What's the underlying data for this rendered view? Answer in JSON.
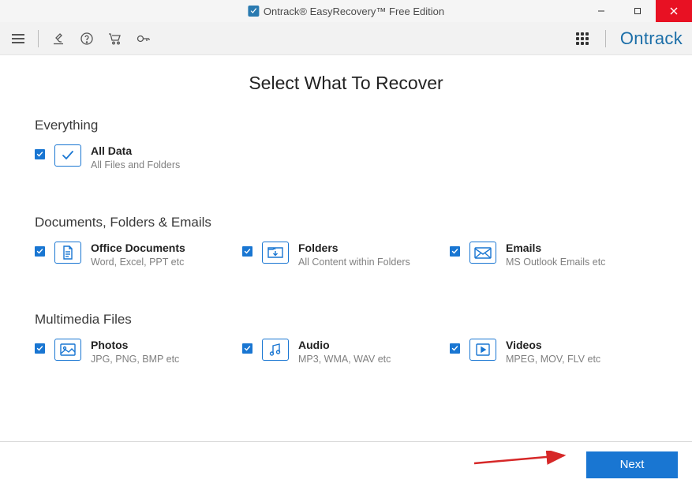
{
  "titlebar": {
    "title": "Ontrack® EasyRecovery™ Free Edition"
  },
  "brand": "Ontrack",
  "page_title": "Select What To Recover",
  "sections": {
    "everything": {
      "title": "Everything",
      "all_data": {
        "label": "All Data",
        "sub": "All Files and Folders"
      }
    },
    "docs": {
      "title": "Documents, Folders & Emails",
      "office": {
        "label": "Office Documents",
        "sub": "Word, Excel, PPT etc"
      },
      "folders": {
        "label": "Folders",
        "sub": "All Content within Folders"
      },
      "emails": {
        "label": "Emails",
        "sub": "MS Outlook Emails etc"
      }
    },
    "multimedia": {
      "title": "Multimedia Files",
      "photos": {
        "label": "Photos",
        "sub": "JPG, PNG, BMP etc"
      },
      "audio": {
        "label": "Audio",
        "sub": "MP3, WMA, WAV etc"
      },
      "videos": {
        "label": "Videos",
        "sub": "MPEG, MOV, FLV etc"
      }
    }
  },
  "footer": {
    "next": "Next"
  }
}
